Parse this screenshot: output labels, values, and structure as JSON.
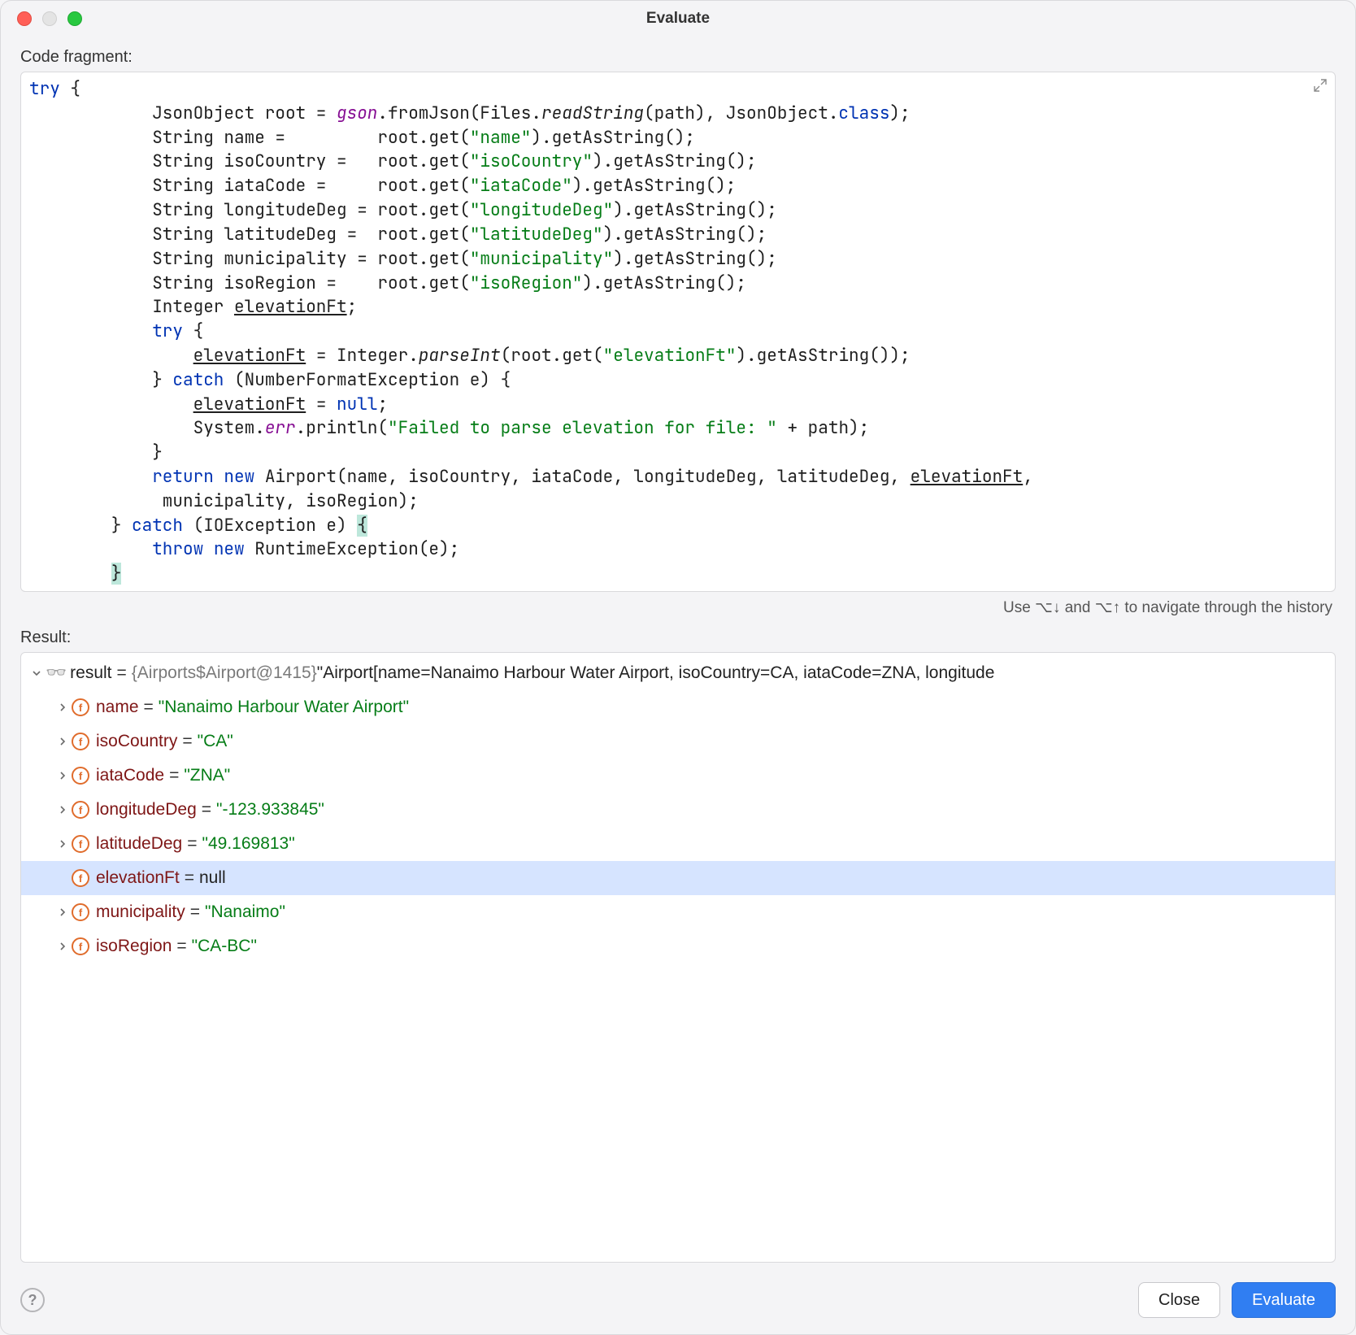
{
  "window": {
    "title": "Evaluate"
  },
  "labels": {
    "codeFragment": "Code fragment:",
    "historyHelp": "Use ⌥↓ and ⌥↑ to navigate through the history",
    "result": "Result:"
  },
  "code": {
    "tokens": [
      [
        {
          "t": "try",
          "c": "kw"
        },
        {
          "t": " {",
          "c": ""
        }
      ],
      [
        {
          "t": "            JsonObject root = ",
          "c": ""
        },
        {
          "t": "gson",
          "c": "field-it"
        },
        {
          "t": ".fromJson(Files.",
          "c": ""
        },
        {
          "t": "readString",
          "c": "static-it"
        },
        {
          "t": "(path), JsonObject.",
          "c": ""
        },
        {
          "t": "class",
          "c": "kw"
        },
        {
          "t": ");",
          "c": ""
        }
      ],
      [
        {
          "t": "            String name =         root.get(",
          "c": ""
        },
        {
          "t": "\"name\"",
          "c": "str"
        },
        {
          "t": ").getAsString();",
          "c": ""
        }
      ],
      [
        {
          "t": "            String isoCountry =   root.get(",
          "c": ""
        },
        {
          "t": "\"isoCountry\"",
          "c": "str"
        },
        {
          "t": ").getAsString();",
          "c": ""
        }
      ],
      [
        {
          "t": "            String iataCode =     root.get(",
          "c": ""
        },
        {
          "t": "\"iataCode\"",
          "c": "str"
        },
        {
          "t": ").getAsString();",
          "c": ""
        }
      ],
      [
        {
          "t": "            String longitudeDeg = root.get(",
          "c": ""
        },
        {
          "t": "\"longitudeDeg\"",
          "c": "str"
        },
        {
          "t": ").getAsString();",
          "c": ""
        }
      ],
      [
        {
          "t": "            String latitudeDeg =  root.get(",
          "c": ""
        },
        {
          "t": "\"latitudeDeg\"",
          "c": "str"
        },
        {
          "t": ").getAsString();",
          "c": ""
        }
      ],
      [
        {
          "t": "            String municipality = root.get(",
          "c": ""
        },
        {
          "t": "\"municipality\"",
          "c": "str"
        },
        {
          "t": ").getAsString();",
          "c": ""
        }
      ],
      [
        {
          "t": "            String isoRegion =    root.get(",
          "c": ""
        },
        {
          "t": "\"isoRegion\"",
          "c": "str"
        },
        {
          "t": ").getAsString();",
          "c": ""
        }
      ],
      [
        {
          "t": "            Integer ",
          "c": ""
        },
        {
          "t": "elevationFt",
          "c": "underline"
        },
        {
          "t": ";",
          "c": ""
        }
      ],
      [
        {
          "t": "            ",
          "c": ""
        },
        {
          "t": "try",
          "c": "kw"
        },
        {
          "t": " {",
          "c": ""
        }
      ],
      [
        {
          "t": "                ",
          "c": ""
        },
        {
          "t": "elevationFt",
          "c": "underline"
        },
        {
          "t": " = Integer.",
          "c": ""
        },
        {
          "t": "parseInt",
          "c": "static-it"
        },
        {
          "t": "(root.get(",
          "c": ""
        },
        {
          "t": "\"elevationFt\"",
          "c": "str"
        },
        {
          "t": ").getAsString());",
          "c": ""
        }
      ],
      [
        {
          "t": "            } ",
          "c": ""
        },
        {
          "t": "catch",
          "c": "kw"
        },
        {
          "t": " (NumberFormatException e) {",
          "c": ""
        }
      ],
      [
        {
          "t": "                ",
          "c": ""
        },
        {
          "t": "elevationFt",
          "c": "underline"
        },
        {
          "t": " = ",
          "c": ""
        },
        {
          "t": "null",
          "c": "kw"
        },
        {
          "t": ";",
          "c": ""
        }
      ],
      [
        {
          "t": "                System.",
          "c": ""
        },
        {
          "t": "err",
          "c": "field-it"
        },
        {
          "t": ".println(",
          "c": ""
        },
        {
          "t": "\"Failed to parse elevation for file: \"",
          "c": "str"
        },
        {
          "t": " + path);",
          "c": ""
        }
      ],
      [
        {
          "t": "            }",
          "c": ""
        }
      ],
      [
        {
          "t": "            ",
          "c": ""
        },
        {
          "t": "return",
          "c": "kw"
        },
        {
          "t": " ",
          "c": ""
        },
        {
          "t": "new",
          "c": "kw"
        },
        {
          "t": " Airport(name, isoCountry, iataCode, longitudeDeg, latitudeDeg, ",
          "c": ""
        },
        {
          "t": "elevationFt",
          "c": "underline"
        },
        {
          "t": ",",
          "c": ""
        }
      ],
      [
        {
          "t": "             municipality, isoRegion);",
          "c": ""
        }
      ],
      [
        {
          "t": "        } ",
          "c": ""
        },
        {
          "t": "catch",
          "c": "kw"
        },
        {
          "t": " (IOException e) ",
          "c": ""
        },
        {
          "t": "{",
          "c": "hl-brace"
        }
      ],
      [
        {
          "t": "            ",
          "c": ""
        },
        {
          "t": "throw",
          "c": "kw"
        },
        {
          "t": " ",
          "c": ""
        },
        {
          "t": "new",
          "c": "kw"
        },
        {
          "t": " RuntimeException(e);",
          "c": ""
        }
      ],
      [
        {
          "t": "        ",
          "c": ""
        },
        {
          "t": "}",
          "c": "hl-brace"
        }
      ]
    ]
  },
  "result": {
    "root": {
      "name": "result",
      "typeGray": "{Airports$Airport@1415}",
      "valueQuoted": "\"Airport[name=Nanaimo Harbour Water Airport, isoCountry=CA, iataCode=ZNA, longitude"
    },
    "fields": [
      {
        "name": "name",
        "value": "\"Nanaimo Harbour Water Airport\"",
        "null": false,
        "expandable": true,
        "selected": false
      },
      {
        "name": "isoCountry",
        "value": "\"CA\"",
        "null": false,
        "expandable": true,
        "selected": false
      },
      {
        "name": "iataCode",
        "value": "\"ZNA\"",
        "null": false,
        "expandable": true,
        "selected": false
      },
      {
        "name": "longitudeDeg",
        "value": "\"-123.933845\"",
        "null": false,
        "expandable": true,
        "selected": false
      },
      {
        "name": "latitudeDeg",
        "value": "\"49.169813\"",
        "null": false,
        "expandable": true,
        "selected": false
      },
      {
        "name": "elevationFt",
        "value": "null",
        "null": true,
        "expandable": false,
        "selected": true
      },
      {
        "name": "municipality",
        "value": "\"Nanaimo\"",
        "null": false,
        "expandable": true,
        "selected": false
      },
      {
        "name": "isoRegion",
        "value": "\"CA-BC\"",
        "null": false,
        "expandable": true,
        "selected": false
      }
    ]
  },
  "buttons": {
    "close": "Close",
    "evaluate": "Evaluate"
  }
}
